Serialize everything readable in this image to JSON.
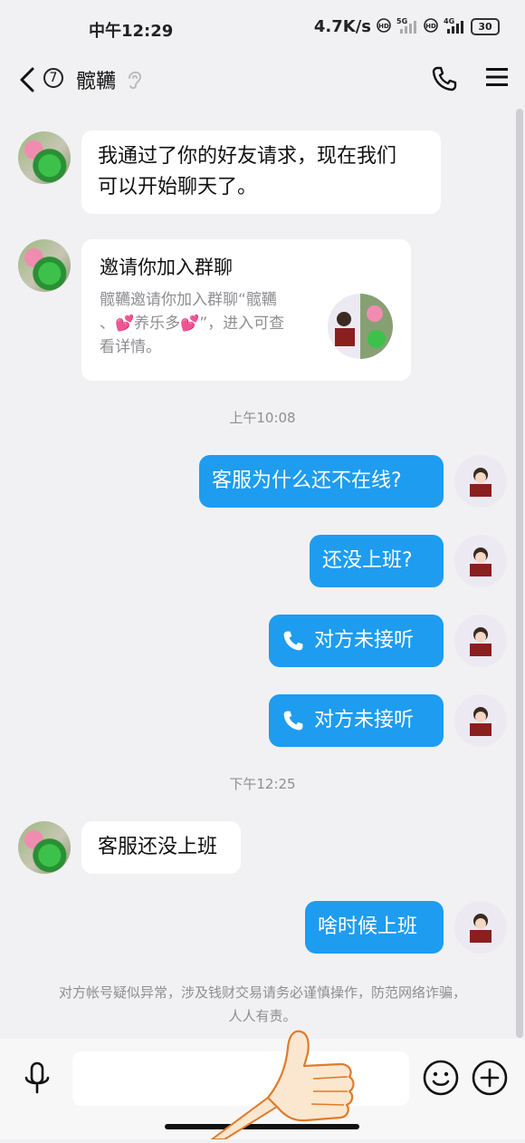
{
  "status_bar": {
    "time": "中午12:29",
    "speed": "4.7K/s",
    "net1": "5G",
    "net2": "4G",
    "hd": "HD",
    "battery": "30"
  },
  "header": {
    "unread_count": "7",
    "contact_name": "髋韉"
  },
  "messages": [
    {
      "type": "text",
      "side": "in",
      "text_line1": "我通过了你的好友请求，现在我们",
      "text_line2": "可以开始聊天了。"
    },
    {
      "type": "card",
      "side": "in",
      "title": "邀请你加入群聊",
      "desc_line1": "髋韉邀请你加入群聊“髋韉",
      "desc_line2": "、💕养乐多💕”，进入可查",
      "desc_line3": "看详情。"
    },
    {
      "type": "timestamp",
      "text": "上午10:08"
    },
    {
      "type": "text",
      "side": "out",
      "text": "客服为什么还不在线?"
    },
    {
      "type": "text",
      "side": "out",
      "text": "还没上班?"
    },
    {
      "type": "call",
      "side": "out",
      "text": "对方未接听"
    },
    {
      "type": "call",
      "side": "out",
      "text": "对方未接听"
    },
    {
      "type": "timestamp",
      "text": "下午12:25"
    },
    {
      "type": "text",
      "side": "in",
      "text": "客服还没上班"
    },
    {
      "type": "text",
      "side": "out",
      "text": "啥时候上班"
    }
  ],
  "notice": {
    "line1": "对方帐号疑似异常，涉及钱财交易请务必谨慎操作，防范网络诈骗，",
    "line2": "人人有责。"
  },
  "input_bar": {
    "placeholder": ""
  },
  "colors": {
    "background": "#f1f1f3",
    "bubble_out": "#1e9cf0",
    "bubble_in": "#ffffff",
    "muted_text": "#8e8e93"
  },
  "icons": [
    "back-arrow-icon",
    "ear-icon",
    "phone-icon",
    "menu-icon",
    "mic-icon",
    "emoji-icon",
    "plus-icon",
    "call-icon",
    "thumbs-up-icon"
  ]
}
